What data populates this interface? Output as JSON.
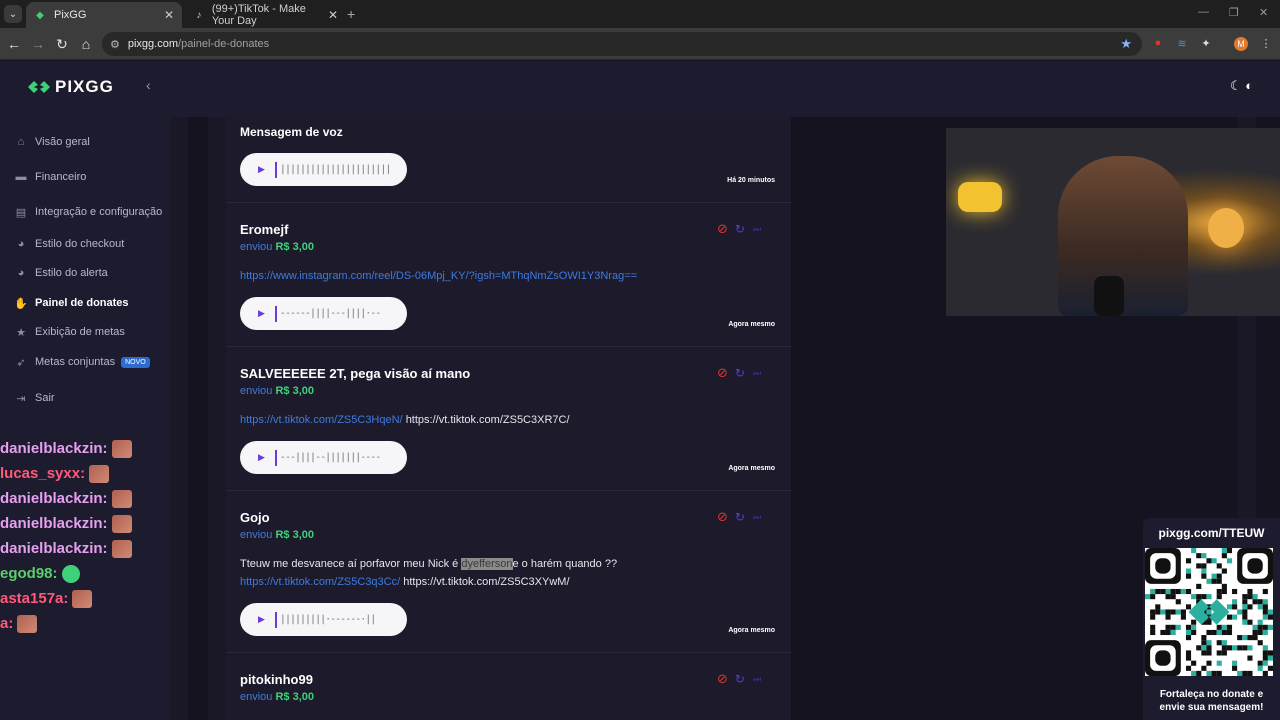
{
  "browser": {
    "tabs": [
      {
        "title": "PixGG",
        "active": true
      },
      {
        "title": "(99+)TikTok - Make Your Day",
        "active": false
      }
    ],
    "url_host": "pixgg.com",
    "url_path": "/painel-de-donates"
  },
  "sidebar": {
    "logo_text": "PIXGG",
    "items": [
      {
        "label": "Visão geral",
        "icon": "home-icon"
      },
      {
        "label": "Financeiro",
        "icon": "wallet-icon"
      },
      {
        "label": "Integração e configuração",
        "icon": "settings-icon"
      },
      {
        "label": "Estilo do checkout",
        "icon": "palette-icon"
      },
      {
        "label": "Estilo do alerta",
        "icon": "palette-icon"
      },
      {
        "label": "Painel de donates",
        "icon": "donate-icon"
      },
      {
        "label": "Exibição de metas",
        "icon": "star-icon"
      },
      {
        "label": "Metas conjuntas",
        "icon": "rocket-icon",
        "badge": "NOVO"
      },
      {
        "label": "Sair",
        "icon": "logout-icon"
      }
    ]
  },
  "chat": [
    {
      "user": "danielblackzin:",
      "color": "#e6a0f0"
    },
    {
      "user": "lucas_syxx:",
      "color": "#ff5a7a"
    },
    {
      "user": "danielblackzin:",
      "color": "#e6a0f0"
    },
    {
      "user": "danielblackzin:",
      "color": "#e6a0f0"
    },
    {
      "user": "danielblackzin:",
      "color": "#e6a0f0"
    },
    {
      "user": "egod98:",
      "color": "#5ad06a"
    },
    {
      "user": "asta157a:",
      "color": "#ff5a7a"
    },
    {
      "user": "a:",
      "color": "#ff5a7a"
    }
  ],
  "donations": {
    "voice_header": "Mensagem de voz",
    "first_time": "Há 20 minutos",
    "sent_label": "enviou",
    "items": [
      {
        "name": "Eromejf",
        "amount": "R$ 3,00",
        "link": "https://www.instagram.com/reel/DS-06Mpj_KY/?igsh=MThqNmZsOWI1Y3Nrag==",
        "time": "Agora mesmo"
      },
      {
        "name": "SALVEEEEEE 2T, pega visão aí mano",
        "amount": "R$ 3,00",
        "link": "https://vt.tiktok.com/ZS5C3HqeN/",
        "link2": "https://vt.tiktok.com/ZS5C3XR7C/",
        "time": "Agora mesmo"
      },
      {
        "name": "Gojo",
        "amount": "R$ 3,00",
        "text_before": "Tteuw me desvanece aí porfavor meu Nick é ",
        "text_highlight": "dyefferson",
        "text_after": "e o harém quando ??",
        "link": "https://vt.tiktok.com/ZS5C3q3Cc/",
        "link2": "https://vt.tiktok.com/ZS5C3XYwM/",
        "time": "Agora mesmo"
      },
      {
        "name": "pitokinho99",
        "amount": "R$ 3,00"
      }
    ]
  },
  "qr": {
    "title": "pixgg.com/TTEUW",
    "footer_line1": "Fortaleça no donate e",
    "footer_line2": "envie sua mensagem!"
  }
}
